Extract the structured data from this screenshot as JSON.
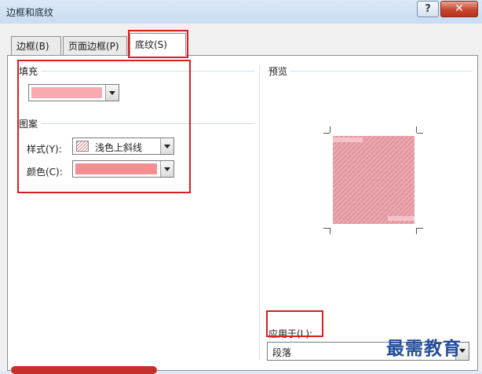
{
  "window": {
    "title": "边框和底纹",
    "help_label": "?",
    "close_label": "✕"
  },
  "tabs": [
    {
      "label": "边框(B)",
      "active": false
    },
    {
      "label": "页面边框(P)",
      "active": false
    },
    {
      "label": "底纹(S)",
      "active": true
    }
  ],
  "fill": {
    "group_label": "填充",
    "color": "#f9a9b0"
  },
  "pattern": {
    "group_label": "图案",
    "style_label": "样式(Y):",
    "style_value": "浅色上斜线",
    "color_label": "颜色(C):",
    "color_value": "#f58e93"
  },
  "preview": {
    "group_label": "预览",
    "color": "#eda6ad"
  },
  "apply": {
    "label": "应用于(L):",
    "value": "段落"
  },
  "watermark": "最需教育",
  "colors": {
    "highlight": "#d81e1e"
  }
}
